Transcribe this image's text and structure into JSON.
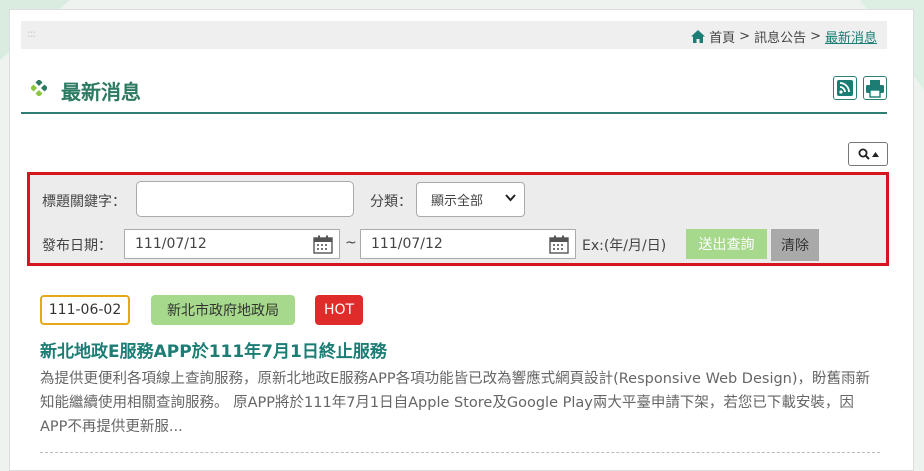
{
  "breadcrumb": {
    "home": "首頁",
    "sep1": ">",
    "section": "訊息公告",
    "sep2": ">",
    "current": "最新消息"
  },
  "page_title": "最新消息",
  "toolbar": {
    "rss_icon": "rss-icon",
    "print_icon": "print-icon",
    "search_toggle_icon": "search-icon"
  },
  "search": {
    "keyword_label": "標題關鍵字：",
    "keyword_value": "",
    "category_label": "分類：",
    "category_value": "顯示全部",
    "date_label": "發布日期：",
    "date_from": "111/07/12",
    "date_sep": "~",
    "date_to": "111/07/12",
    "date_hint": "Ex:(年/月/日)",
    "submit_label": "送出查詢",
    "clear_label": "清除"
  },
  "news": [
    {
      "date": "111-06-02",
      "unit": "新北市政府地政局",
      "tag": "HOT",
      "title": "新北地政E服務APP於111年7月1日終止服務",
      "summary": "為提供更便利各項線上查詢服務，原新北地政E服務APP各項功能皆已改為響應式網頁設計(Responsive Web Design)，盼舊雨新知能繼續使用相關查詢服務。 原APP將於111年7月1日自Apple Store及Google Play兩大平臺申請下架，若您已下載安裝，因APP不再提供更新服..."
    }
  ],
  "colors": {
    "accent": "#2c7a62",
    "link": "#1b7d74",
    "highlight_border": "#d6161d",
    "hot": "#e02b2b",
    "unit_badge": "#a6d98b",
    "date_badge_border": "#e6a817"
  }
}
